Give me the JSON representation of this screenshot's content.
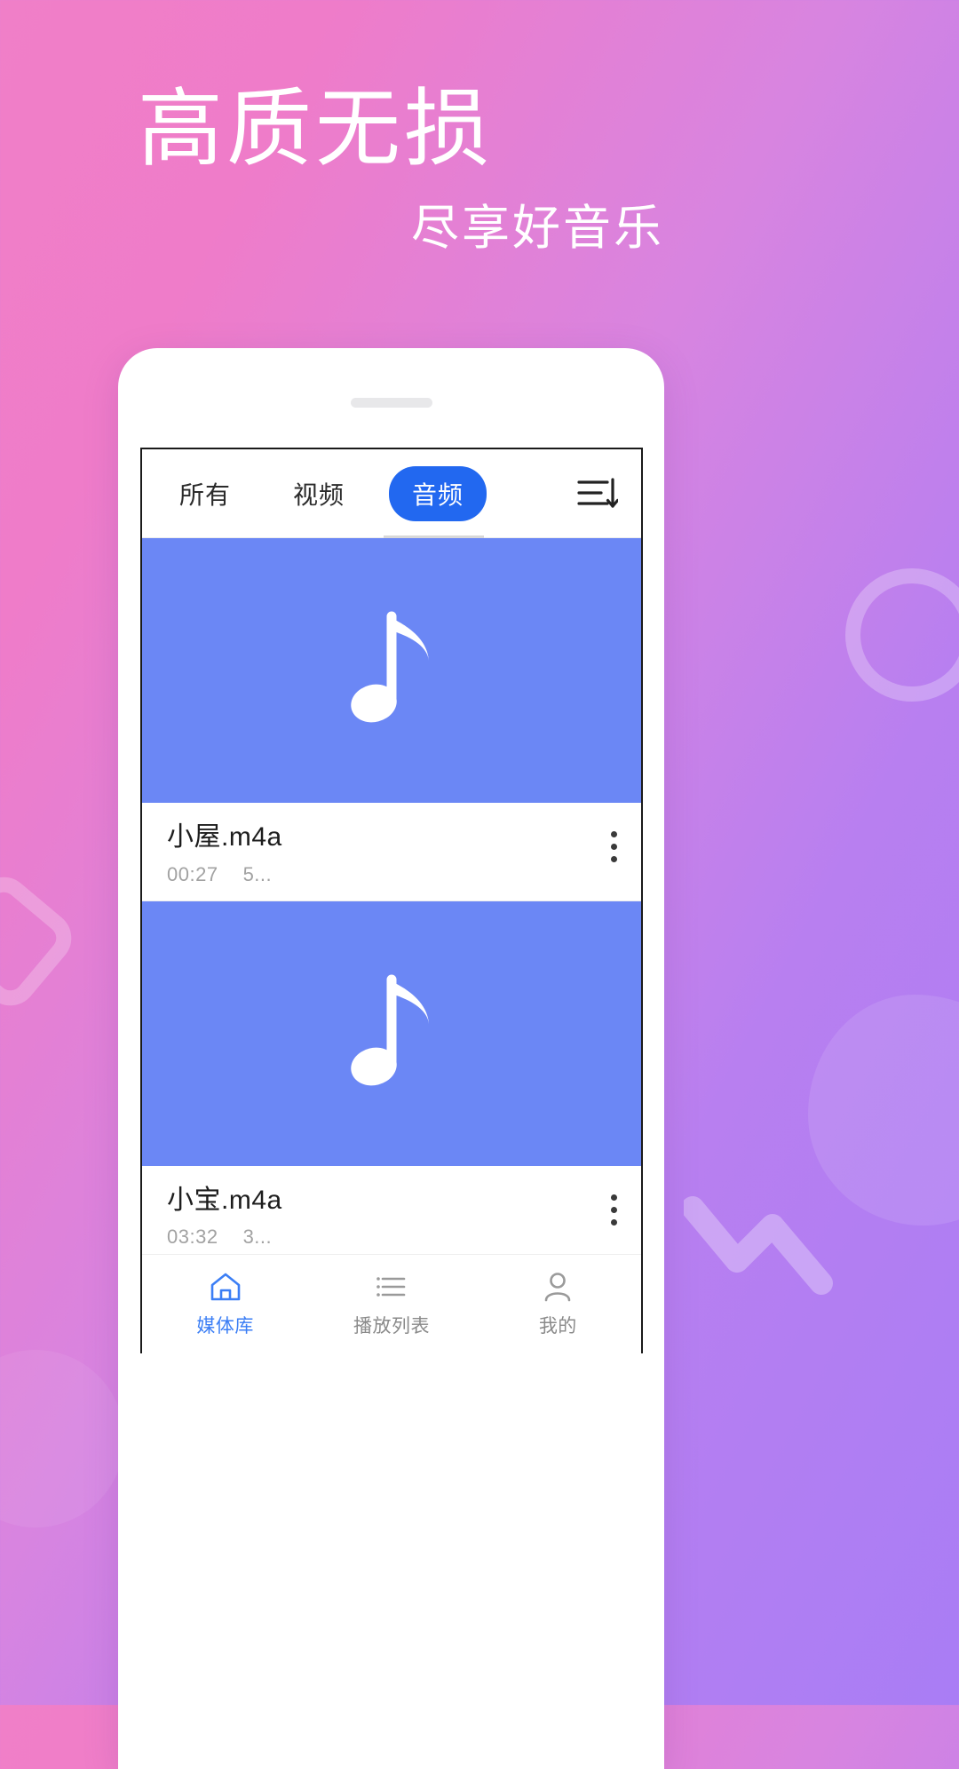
{
  "promo": {
    "headline": "高质无损",
    "subheadline": "尽享好音乐",
    "brand_gradient_from": "#f07fc8",
    "brand_gradient_to": "#a97df5",
    "text_color": "#ffffff"
  },
  "app": {
    "accent_color": "#2268f0",
    "thumb_color": "#6b87f5",
    "tabs": [
      {
        "label": "所有",
        "selected": false
      },
      {
        "label": "视频",
        "selected": false
      },
      {
        "label": "音频",
        "selected": true
      }
    ],
    "sort_icon": "sort-descending-icon",
    "media": [
      {
        "title": "小屋.m4a",
        "duration": "00:27",
        "size": "5...",
        "thumb_icon": "music-note-icon",
        "more_icon": "more-vertical-icon"
      },
      {
        "title": "小宝.m4a",
        "duration": "03:32",
        "size": "3...",
        "thumb_icon": "music-note-icon",
        "more_icon": "more-vertical-icon"
      }
    ],
    "bottom_nav": [
      {
        "label": "媒体库",
        "icon": "home-icon",
        "active": true
      },
      {
        "label": "播放列表",
        "icon": "list-icon",
        "active": false
      },
      {
        "label": "我的",
        "icon": "person-icon",
        "active": false
      }
    ]
  }
}
